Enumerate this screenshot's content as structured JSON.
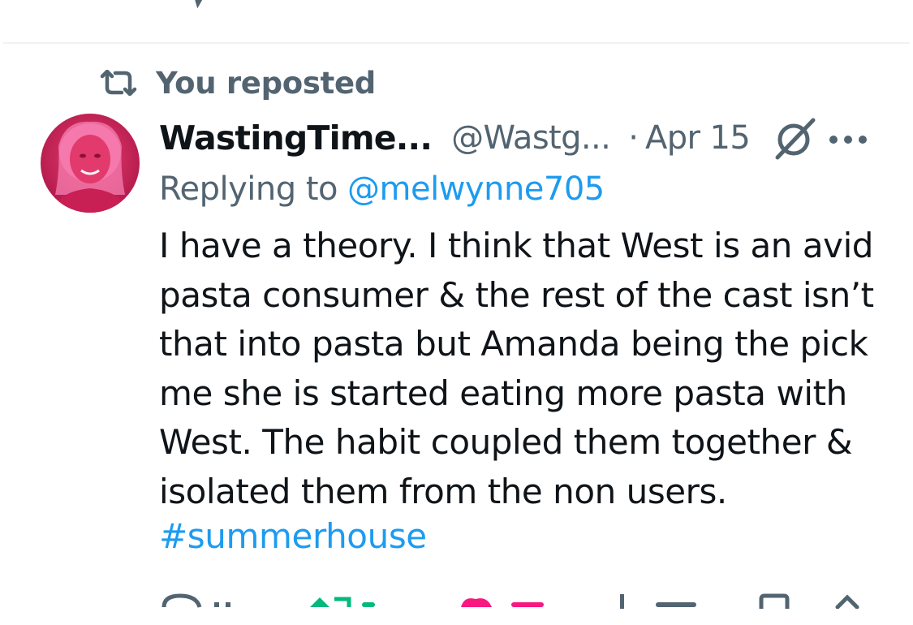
{
  "repost_banner": {
    "text": "You reposted",
    "icon": "repost-icon"
  },
  "tweet": {
    "display_name": "WastingTime...",
    "handle": "@Wastg...",
    "separator": "·",
    "date": "Apr 15",
    "replying_prefix": "Replying to",
    "replying_to": "@melwynne705",
    "body": "I have a theory. I think that West is an avid\npasta consumer & the rest of the cast isn’t\nthat into pasta but Amanda being the pick\nme she is started eating more pasta with\nWest. The habit coupled them together &\nisolated them from the non users.",
    "hashtag": "#summerhouse"
  },
  "colors": {
    "text_primary": "#0f1419",
    "text_secondary": "#536471",
    "link": "#1d9bf0",
    "like_pink": "#f91880",
    "repost_green": "#00ba7c",
    "divider": "#eff3f4"
  }
}
